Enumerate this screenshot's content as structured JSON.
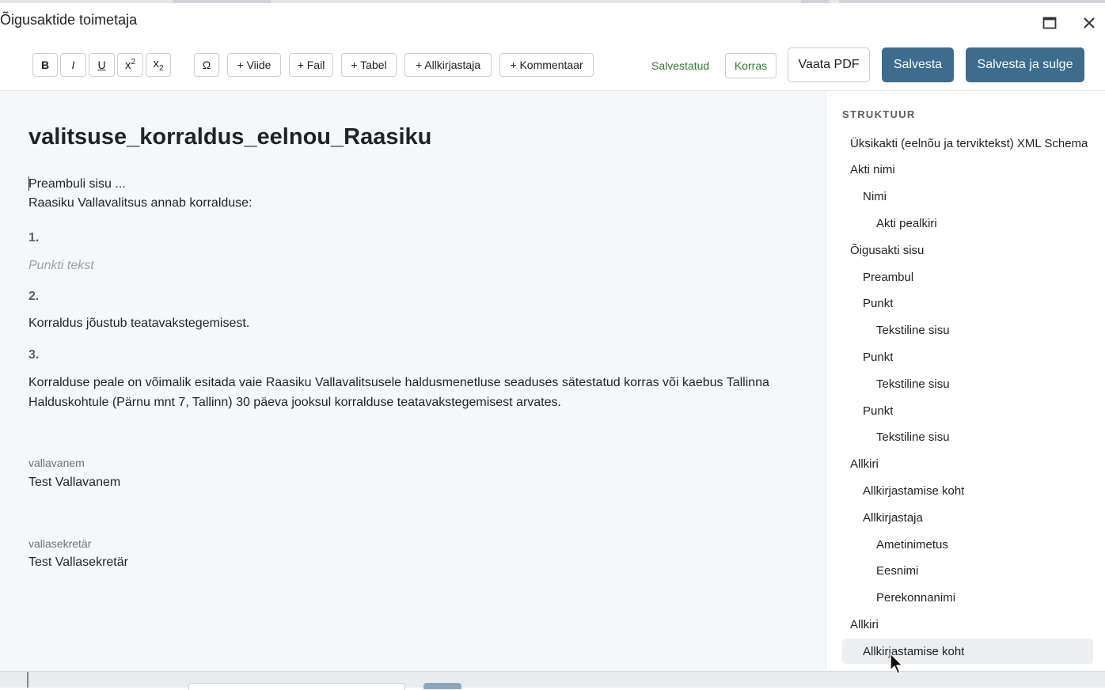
{
  "window": {
    "title": "Õigusaktide toimetaja",
    "maximize_icon": "maximize-icon",
    "close_icon": "close-icon"
  },
  "toolbar": {
    "format": {
      "bold": "B",
      "italic": "I",
      "underline": "U",
      "superscript": "x2",
      "subscript": "x2"
    },
    "omega": "Ω",
    "insert": {
      "viide": "+ Viide",
      "fail": "+ Fail",
      "tabel": "+ Tabel",
      "allkirjastaja": "+ Allkirjastaja",
      "kommentaar": "+ Kommentaar"
    },
    "status_saved": "Salvestatud",
    "status_ok": "Korras",
    "view_pdf": "Vaata PDF",
    "save": "Salvesta",
    "save_close": "Salvesta ja sulge"
  },
  "document": {
    "title": "valitsuse_korraldus_eelnou_Raasiku",
    "preamble": "Preambuli sisu ...",
    "intro": "Raasiku Vallavalitsus annab korralduse:",
    "points": [
      {
        "number": "1.",
        "placeholder": "Punkti tekst",
        "text": ""
      },
      {
        "number": "2.",
        "text": "Korraldus jõustub teatavakstegemisest."
      },
      {
        "number": "3.",
        "text": "Korralduse peale on võimalik esitada vaie Raasiku Vallavalitsusele haldusmenetluse seaduses sätestatud korras või kaebus Tallinna Halduskohtule (Pärnu mnt 7, Tallinn) 30 päeva jooksul korralduse teatavakstegemisest arvates."
      }
    ],
    "signatures": [
      {
        "role": "vallavanem",
        "name": "Test Vallavanem"
      },
      {
        "role": "vallasekretär",
        "name": "Test Vallasekretär"
      }
    ]
  },
  "sidebar": {
    "heading": "STRUKTUUR",
    "items": [
      {
        "label": "Üksikakti (eelnõu ja terviktekst) XML Schema",
        "level": 0
      },
      {
        "label": "Akti nimi",
        "level": 0
      },
      {
        "label": "Nimi",
        "level": 1
      },
      {
        "label": "Akti pealkiri",
        "level": 2
      },
      {
        "label": "Õigusakti sisu",
        "level": 0
      },
      {
        "label": "Preambul",
        "level": 1
      },
      {
        "label": "Punkt",
        "level": 1
      },
      {
        "label": "Tekstiline sisu",
        "level": 2
      },
      {
        "label": "Punkt",
        "level": 1
      },
      {
        "label": "Tekstiline sisu",
        "level": 2
      },
      {
        "label": "Punkt",
        "level": 1
      },
      {
        "label": "Tekstiline sisu",
        "level": 2
      },
      {
        "label": "Allkiri",
        "level": 0
      },
      {
        "label": "Allkirjastamise koht",
        "level": 1
      },
      {
        "label": "Allkirjastaja",
        "level": 1
      },
      {
        "label": "Ametinimetus",
        "level": 2
      },
      {
        "label": "Eesnimi",
        "level": 2
      },
      {
        "label": "Perekonnanimi",
        "level": 2
      },
      {
        "label": "Allkiri",
        "level": 0
      },
      {
        "label": "Allkirjastamise koht",
        "level": 1,
        "selected": true
      }
    ]
  },
  "colors": {
    "primary_button": "#3c6c8e",
    "status_green": "#2e7d32",
    "editor_bg": "#f6f7f9",
    "selected_item_bg": "#eceef1"
  }
}
